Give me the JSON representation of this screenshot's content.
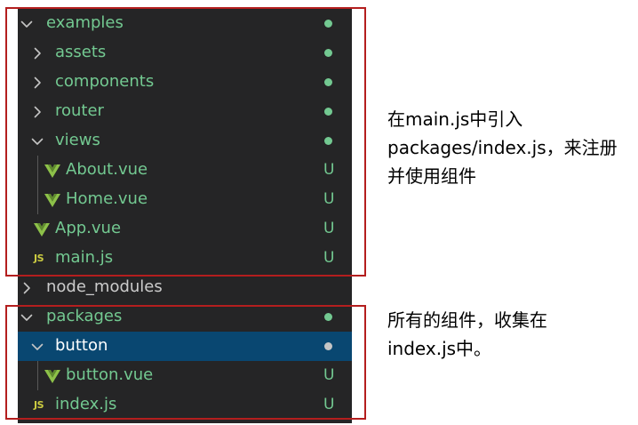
{
  "colors": {
    "panel_bg": "#252526",
    "selected_bg": "#094771",
    "untracked_green": "#73c991",
    "git_dot": "#73c991",
    "selected_dot": "#c5c5c5",
    "folder_text_plain": "#cccccc",
    "vue_icon": "#8dc149",
    "js_icon": "#cbcb41",
    "highlight_box": "#b41e1e"
  },
  "tree": [
    {
      "label": "examples",
      "kind": "folder",
      "open": true,
      "depth": 0,
      "icon": "chevron-down-icon",
      "decoration": "dot"
    },
    {
      "label": "assets",
      "kind": "folder",
      "open": false,
      "depth": 1,
      "icon": "chevron-right-icon",
      "decoration": "dot"
    },
    {
      "label": "components",
      "kind": "folder",
      "open": false,
      "depth": 1,
      "icon": "chevron-right-icon",
      "decoration": "dot"
    },
    {
      "label": "router",
      "kind": "folder",
      "open": false,
      "depth": 1,
      "icon": "chevron-right-icon",
      "decoration": "dot"
    },
    {
      "label": "views",
      "kind": "folder",
      "open": true,
      "depth": 1,
      "icon": "chevron-down-icon",
      "decoration": "dot"
    },
    {
      "label": "About.vue",
      "kind": "vue",
      "depth": 2,
      "icon": "vue-file-icon",
      "status": "U"
    },
    {
      "label": "Home.vue",
      "kind": "vue",
      "depth": 2,
      "icon": "vue-file-icon",
      "status": "U"
    },
    {
      "label": "App.vue",
      "kind": "vue",
      "depth": 1,
      "icon": "vue-file-icon",
      "status": "U"
    },
    {
      "label": "main.js",
      "kind": "js",
      "depth": 1,
      "icon": "js-file-icon",
      "icon_text": "JS",
      "status": "U"
    },
    {
      "label": "node_modules",
      "kind": "folder",
      "open": false,
      "depth": 0,
      "icon": "chevron-right-icon",
      "plain": true
    },
    {
      "label": "packages",
      "kind": "folder",
      "open": true,
      "depth": 0,
      "icon": "chevron-down-icon",
      "decoration": "dot"
    },
    {
      "label": "button",
      "kind": "folder",
      "open": true,
      "depth": 1,
      "icon": "chevron-down-icon",
      "decoration": "dot",
      "selected": true
    },
    {
      "label": "button.vue",
      "kind": "vue",
      "depth": 2,
      "icon": "vue-file-icon",
      "status": "U"
    },
    {
      "label": "index.js",
      "kind": "js",
      "depth": 1,
      "icon": "js-file-icon",
      "icon_text": "JS",
      "status": "U"
    }
  ],
  "annotations": {
    "examples_note": [
      "在main.js中引入",
      "packages/index.js，来注册",
      "并使用组件"
    ],
    "packages_note": [
      "所有的组件，收集在",
      "index.js中。"
    ]
  }
}
